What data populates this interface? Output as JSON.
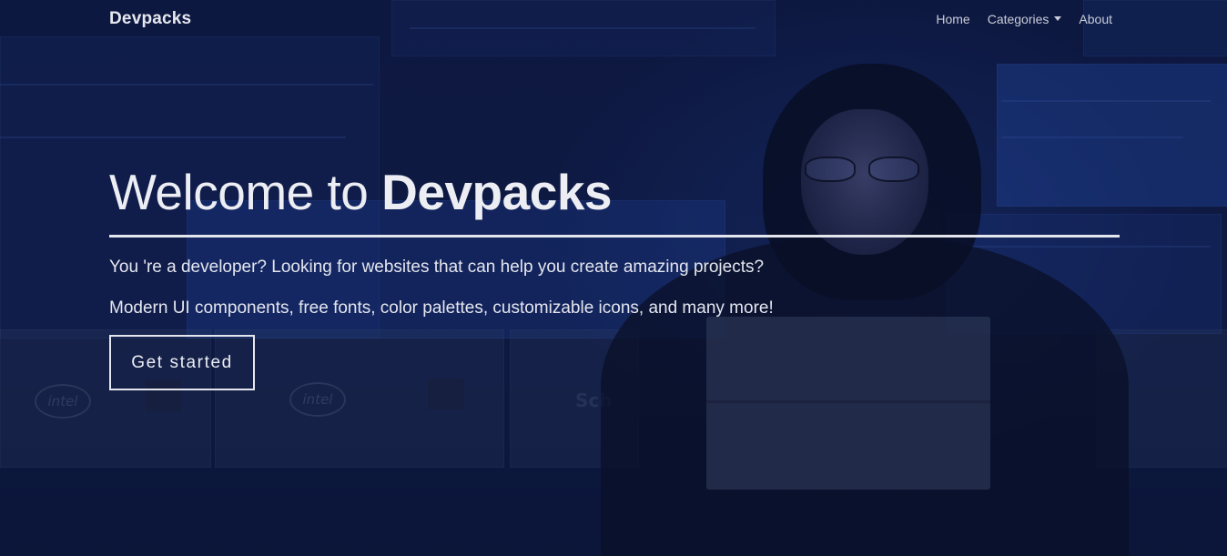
{
  "navbar": {
    "brand": "Devpacks",
    "links": [
      {
        "label": "Home"
      },
      {
        "label": "Categories",
        "has_dropdown": true
      },
      {
        "label": "About"
      }
    ]
  },
  "hero": {
    "title_prefix": "Welcome to ",
    "title_emphasis": "Devpacks",
    "line_1": "You 're a developer? Looking for websites that can help you create amazing projects?",
    "line_2": "Modern UI components, free fonts, color palettes, customizable icons, and many more!",
    "cta_label": "Get started"
  },
  "background": {
    "logo_1": "intel",
    "logo_2": "intel",
    "logo_3": "Sch"
  },
  "colors": {
    "background_navy": "#101b40",
    "text_light": "#eceef4",
    "nav_text": "#c9cdd8"
  },
  "icons": {
    "dropdown": "caret-down-icon"
  }
}
